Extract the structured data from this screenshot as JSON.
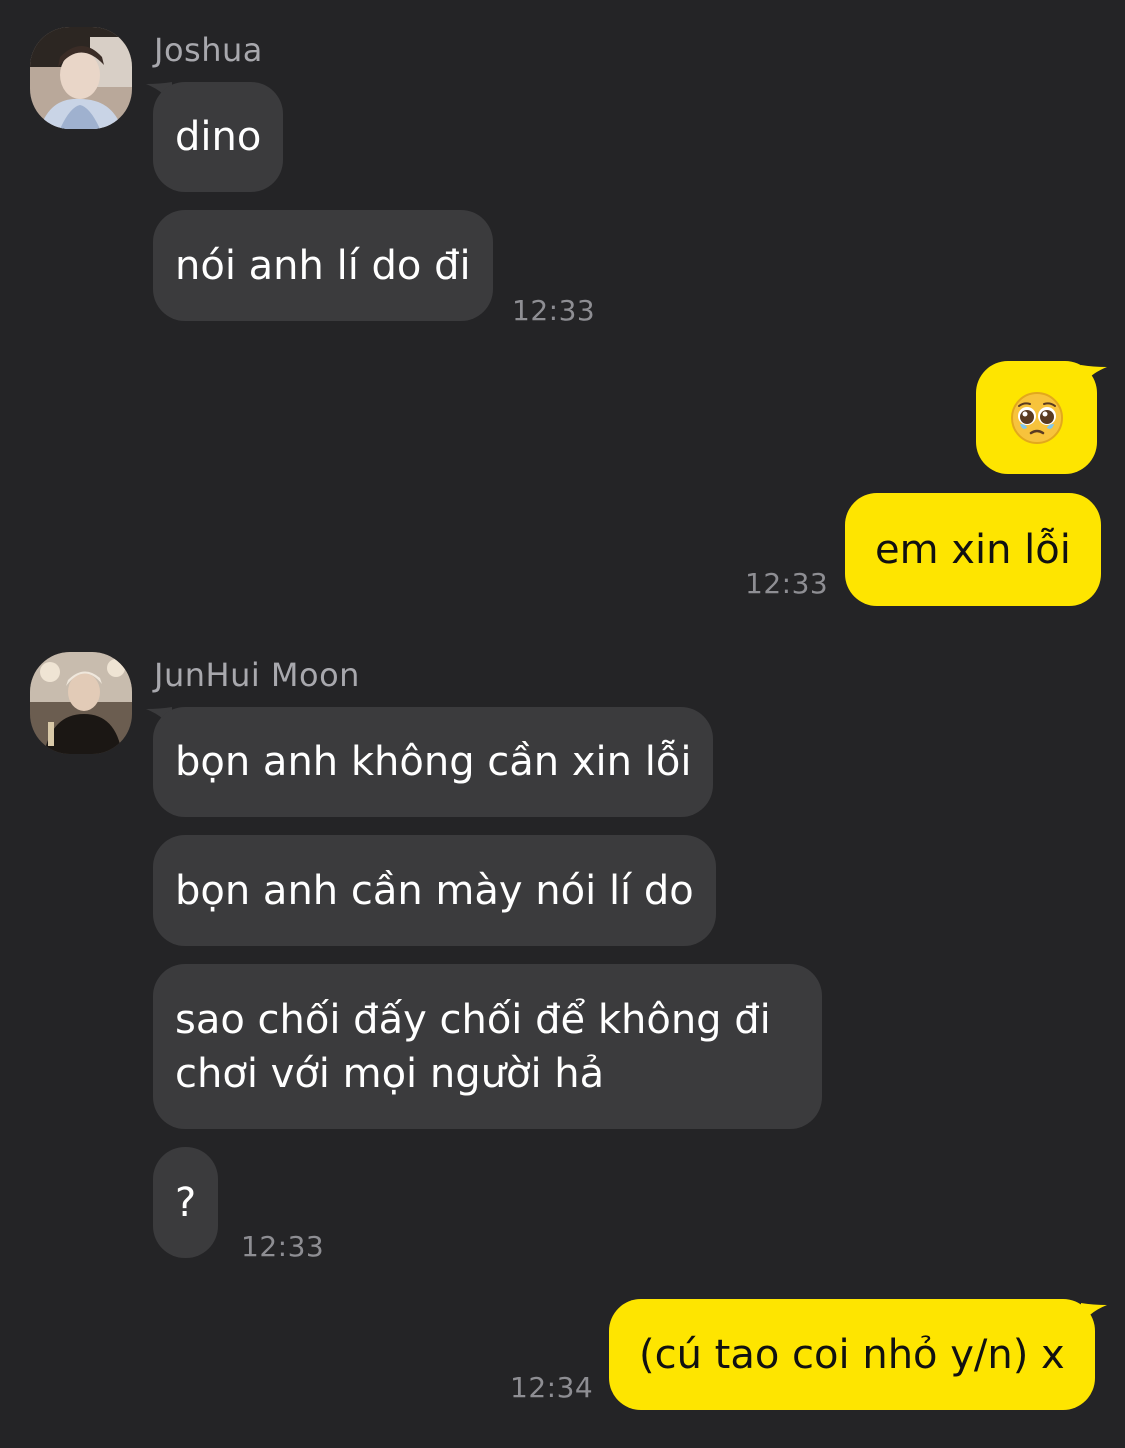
{
  "conversation": {
    "groups": [
      {
        "sender": "Joshua",
        "messages": [
          "dino",
          "nói anh lí do đi"
        ],
        "time": "12:33"
      },
      {
        "outgoing": true,
        "emoji": "pleading-face-emoji",
        "messages": [
          "em xin lỗi"
        ],
        "time": "12:33"
      },
      {
        "sender": "JunHui Moon",
        "messages": [
          "bọn anh không cần xin lỗi",
          "bọn anh cần mày nói lí do",
          "sao chối đấy chối để không đi chơi với mọi người hả",
          "?"
        ],
        "time": "12:33"
      },
      {
        "outgoing": true,
        "messages": [
          "(cú tao coi nhỏ y/n) x"
        ],
        "time": "12:34"
      }
    ]
  },
  "colors": {
    "background": "#242426",
    "incoming_bubble": "#3b3b3d",
    "outgoing_bubble": "#fee500",
    "meta_text": "#8e8e93"
  }
}
